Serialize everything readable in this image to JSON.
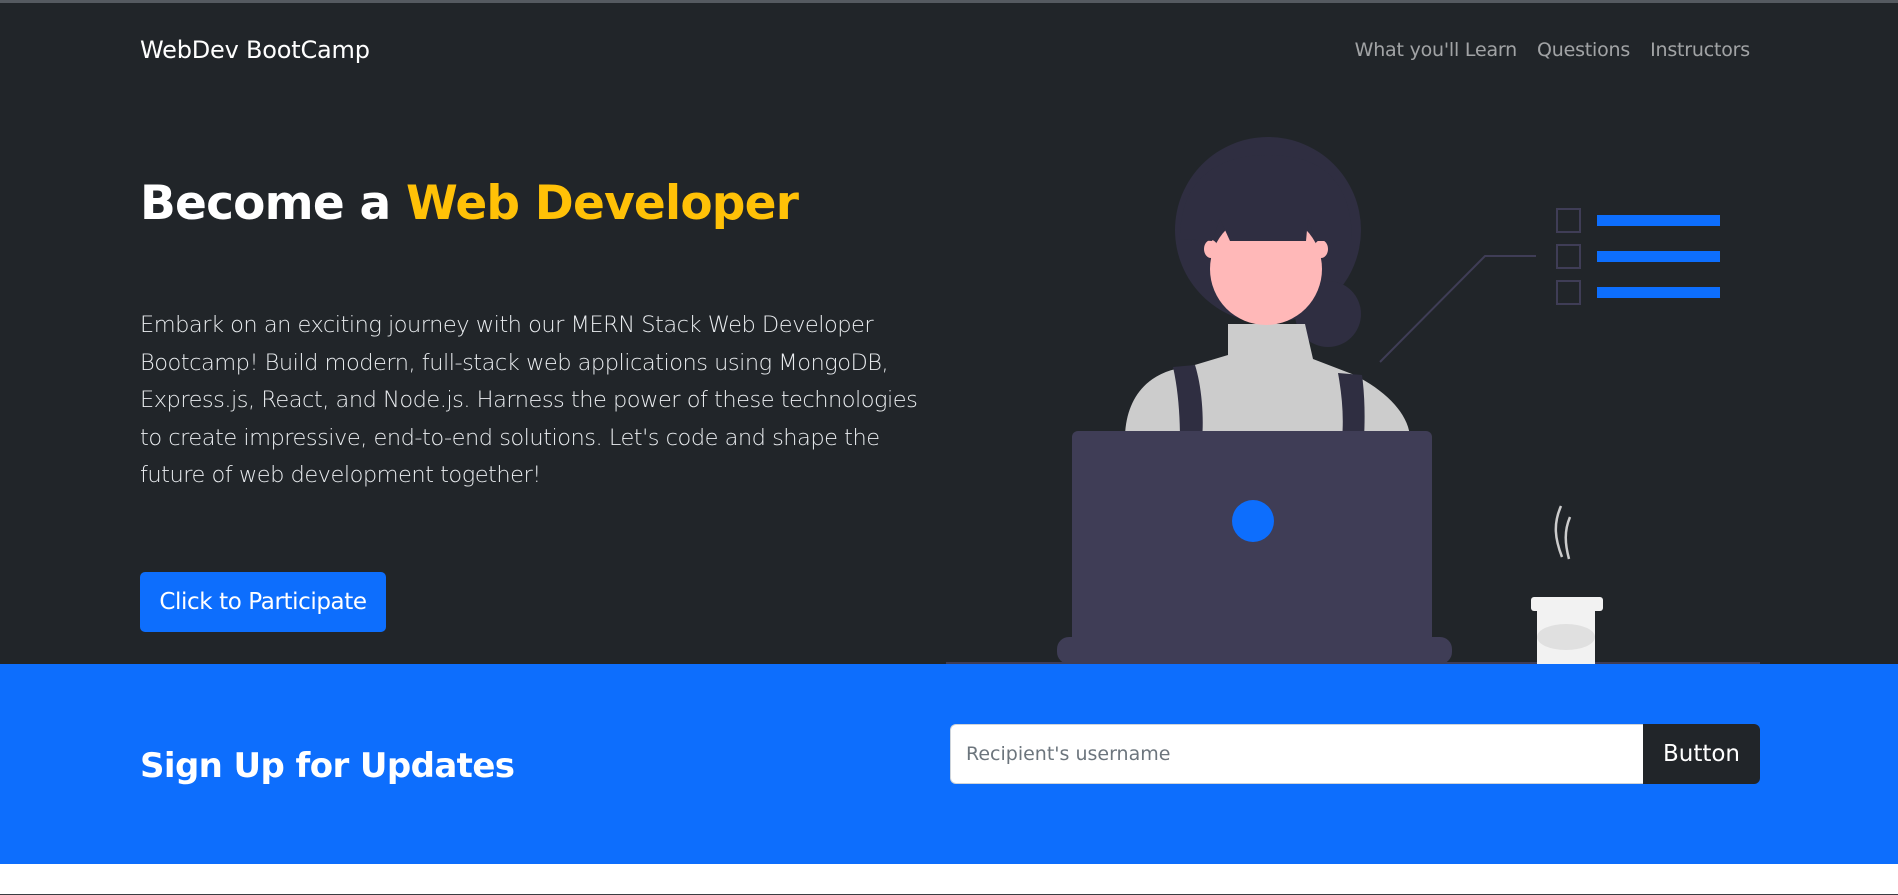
{
  "navbar": {
    "brand": "WebDev BootCamp",
    "links": [
      {
        "label": "What you'll Learn"
      },
      {
        "label": "Questions"
      },
      {
        "label": "Instructors"
      }
    ]
  },
  "hero": {
    "title_prefix": "Become a ",
    "title_accent": "Web Developer",
    "description": "Embark on an exciting journey with our MERN Stack Web Developer Bootcamp! Build modern, full-stack web applications using MongoDB, Express.js, React, and Node.js. Harness the power of these technologies to create impressive, end-to-end solutions. Let's code and shape the future of web development together!",
    "cta_label": "Click to Participate"
  },
  "signup": {
    "title": "Sign Up for Updates",
    "input_placeholder": "Recipient's username",
    "input_value": "",
    "button_label": "Button"
  },
  "illustration": {
    "icon": "woman-with-laptop-illustration",
    "colors": {
      "hair": "#2f2e41",
      "skin": "#ffb8b8",
      "shirt": "#cccccc",
      "laptop": "#3f3d56",
      "laptop_logo": "#0d6efd",
      "list_lines": "#0d6efd",
      "cup": "#f2f2f2"
    }
  },
  "colors": {
    "dark_bg": "#212529",
    "primary": "#0d6efd",
    "accent": "#ffc107",
    "white": "#ffffff"
  }
}
